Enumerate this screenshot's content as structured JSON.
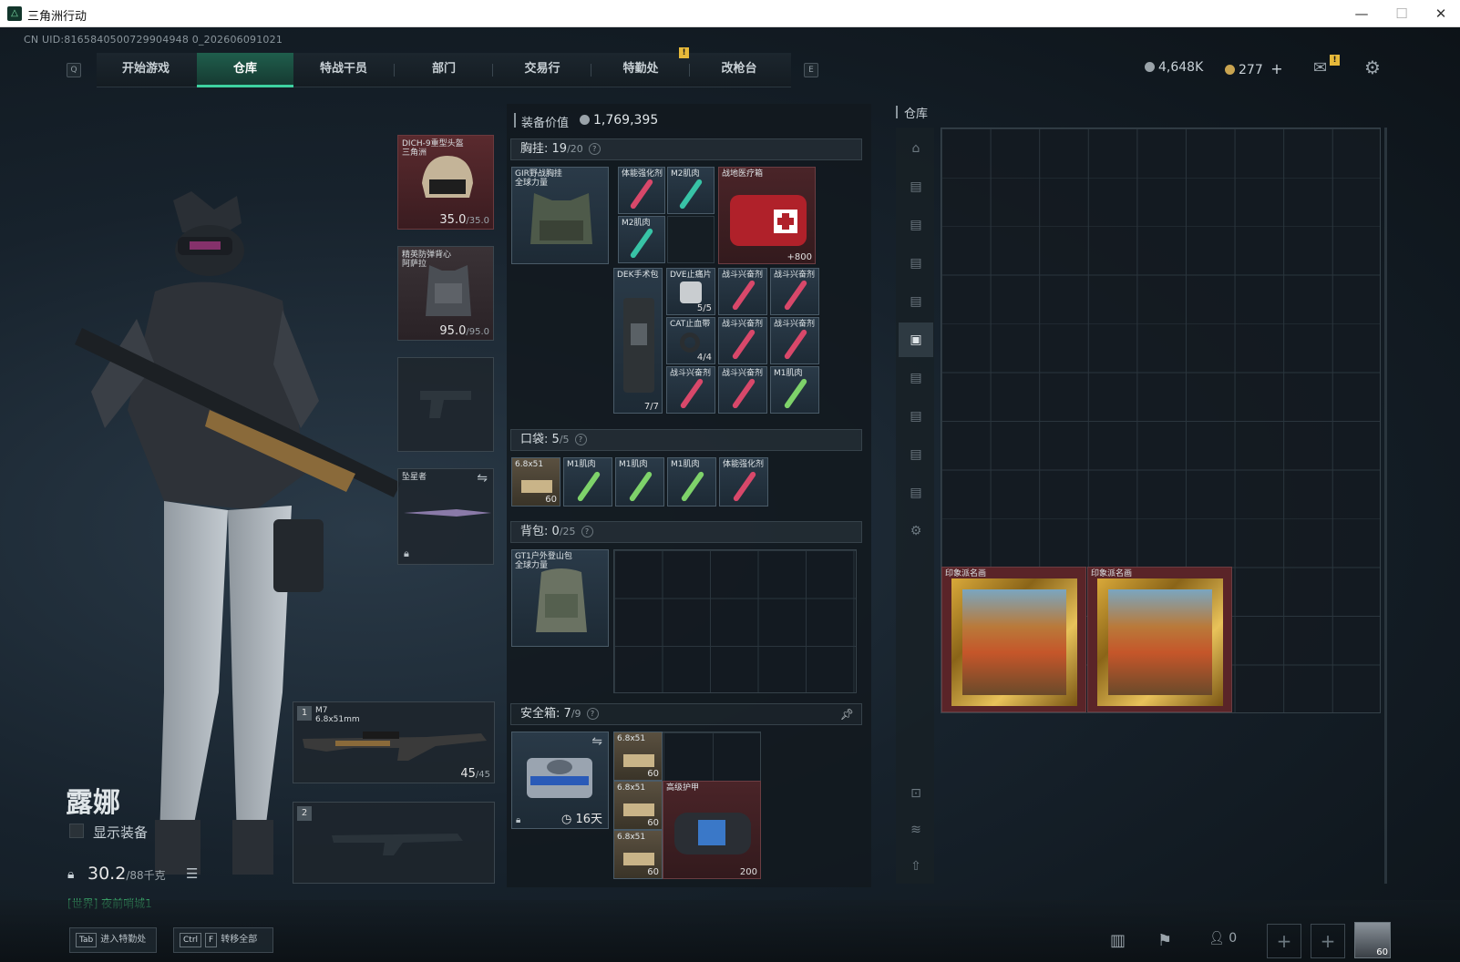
{
  "window": {
    "title": "三角洲行动",
    "minimize": "—",
    "maximize": "☐",
    "close": "✕"
  },
  "uid": "CN UID:8165840500729904948 0_202606091021",
  "nav": {
    "key_left": "Q",
    "key_right": "E",
    "tabs": [
      "开始游戏",
      "仓库",
      "特战干员",
      "部门",
      "交易行",
      "特勤处",
      "改枪台"
    ],
    "active": "仓库",
    "alert": "!"
  },
  "currency": {
    "coins": "4,648K",
    "tokens": "277",
    "add": "+"
  },
  "mail_alert": "!",
  "character": {
    "name": "露娜",
    "show_gear": "显示装备",
    "weight": "30.2",
    "weight_max": "/88千克",
    "chat": "[世界] 夜前哨城1"
  },
  "gear": {
    "helmet": {
      "name": "DICH-9重型头盔",
      "sub": "三角洲",
      "dur": "35.0",
      "max": "/35.0"
    },
    "armor": {
      "name": "精英防弹背心",
      "sub": "阿萨拉",
      "dur": "95.0",
      "max": "/95.0"
    },
    "melee": {
      "name": "坠星者"
    },
    "primary": {
      "slot": "1",
      "name": "M7",
      "sub": "6.8x51mm",
      "ammo": "45",
      "ammo_max": "/45"
    },
    "secondary": {
      "slot": "2"
    }
  },
  "equip_value": {
    "label": "装备价值",
    "value": "1,769,395"
  },
  "chest": {
    "label": "胸挂:",
    "count": "19",
    "max": "/20",
    "q": "?"
  },
  "chest_rig": {
    "name": "GIR野战胸挂",
    "sub": "全球力量"
  },
  "chest_items": [
    {
      "n": "体能强化剂"
    },
    {
      "n": "M2肌肉"
    },
    {
      "n": "战地医疗箱",
      "c": "+800"
    },
    {
      "n": "M2肌肉"
    },
    {
      "n": "DEK手术包",
      "c": "7/7"
    },
    {
      "n": "DVE止痛片",
      "c": "5/5"
    },
    {
      "n": "CAT止血带",
      "c": "4/4"
    },
    {
      "n": "战斗兴奋剂"
    },
    {
      "n": "战斗兴奋剂"
    },
    {
      "n": "战斗兴奋剂"
    },
    {
      "n": "战斗兴奋剂"
    },
    {
      "n": "战斗兴奋剂"
    },
    {
      "n": "战斗兴奋剂"
    },
    {
      "n": "M1肌肉"
    }
  ],
  "pocket": {
    "label": "口袋:",
    "count": "5",
    "max": "/5",
    "q": "?",
    "items": [
      {
        "n": "6.8x51",
        "c": "60"
      },
      {
        "n": "M1肌肉"
      },
      {
        "n": "M1肌肉"
      },
      {
        "n": "M1肌肉"
      },
      {
        "n": "体能强化剂"
      }
    ]
  },
  "backpack": {
    "label": "背包:",
    "count": "0",
    "max": "/25",
    "q": "?",
    "name": "GT1户外登山包",
    "sub": "全球力量"
  },
  "safebox": {
    "label": "安全箱:",
    "count": "7",
    "max": "/9",
    "q": "?",
    "days": "16天",
    "items": [
      {
        "n": "6.8x51",
        "c": "60"
      },
      {
        "n": "6.8x51",
        "c": "60"
      },
      {
        "n": "6.8x51",
        "c": "60"
      },
      {
        "n": "高级护甲",
        "c": "200"
      }
    ]
  },
  "storage": {
    "label": "仓库",
    "paintings": [
      {
        "n": "印象派名画"
      },
      {
        "n": "印象派名画"
      }
    ]
  },
  "bottom": {
    "tab_key": "Tab",
    "tab_label": "进入特勤处",
    "ctrl_key": "Ctrl",
    "f_key": "F",
    "transfer_label": "转移全部",
    "friends": "0",
    "avatar_level": "60"
  },
  "colors": {
    "accent": "#3ed1a0",
    "red_item": "#4a2428",
    "gold": "#d9a93a"
  }
}
